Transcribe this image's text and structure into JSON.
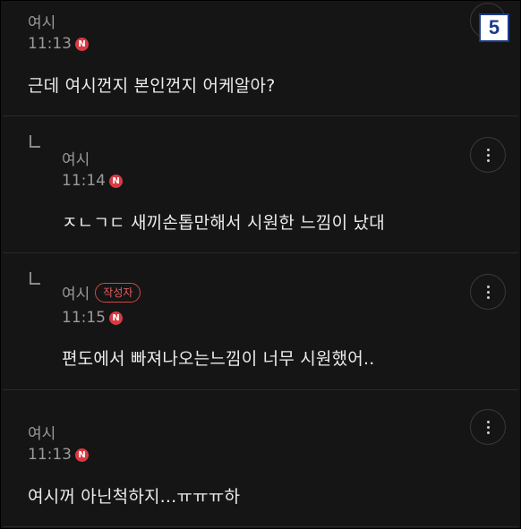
{
  "page_badge": "5",
  "comments": [
    {
      "author": "여시",
      "time": "11:13",
      "new_badge": "N",
      "text": "근데 여시껀지 본인껀지 어케알아?",
      "is_reply": false
    },
    {
      "author": "여시",
      "time": "11:14",
      "new_badge": "N",
      "text": "ㅈㄴㄱㄷ 새끼손톱만해서 시원한 느낌이 났대",
      "is_reply": true
    },
    {
      "author": "여시",
      "writer_badge": "작성자",
      "time": "11:15",
      "new_badge": "N",
      "text": "편도에서 빠져나오는느낌이 너무 시원했어..",
      "is_reply": true
    },
    {
      "author": "여시",
      "time": "11:13",
      "new_badge": "N",
      "text": "여시꺼 아닌척하지...ㅠㅠㅠ하",
      "is_reply": false
    }
  ],
  "colors": {
    "background": "#151515",
    "badge_red": "#d83a43",
    "text": "#ececec",
    "meta": "#9a9a9a"
  },
  "icons": {
    "more": "more-vertical-icon",
    "reply": "reply-arrow-icon"
  }
}
